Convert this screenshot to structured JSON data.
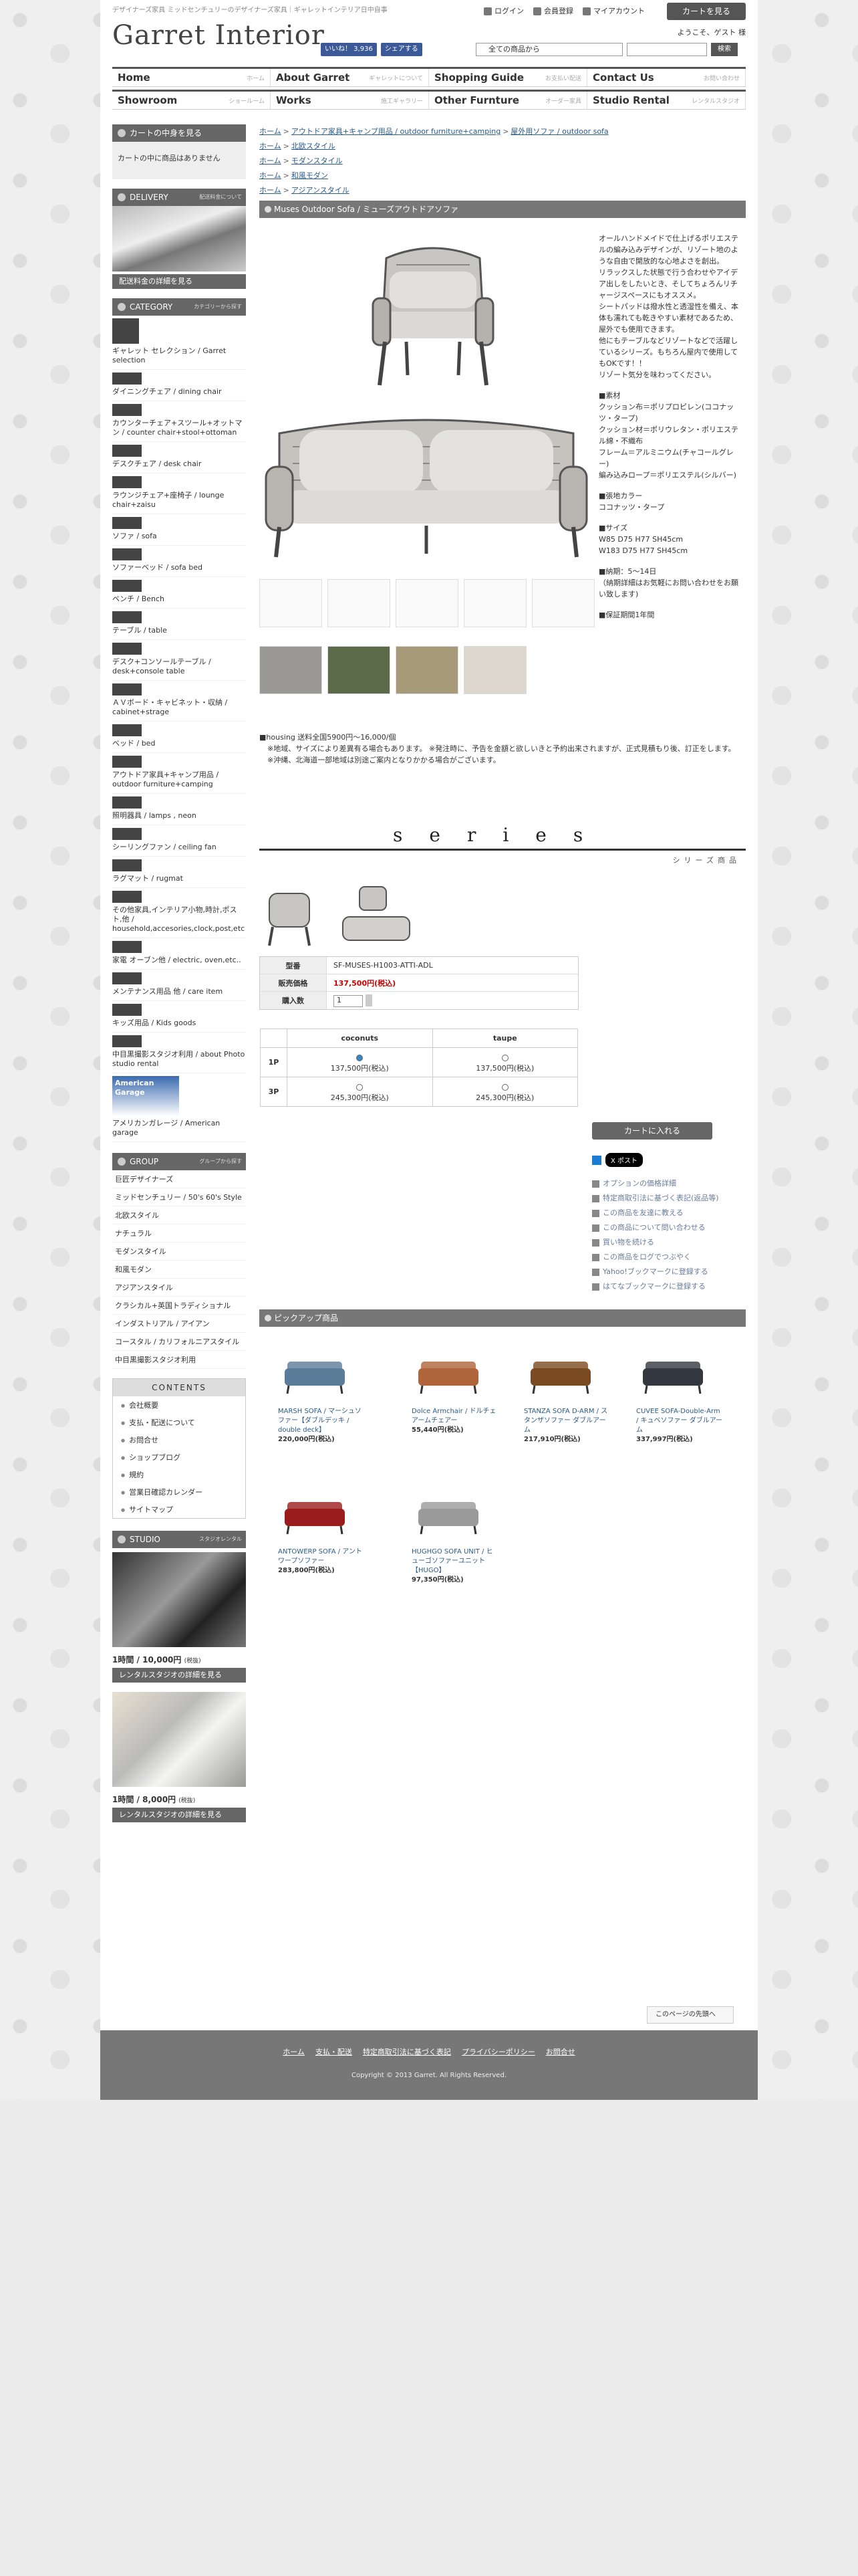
{
  "header": {
    "tagline": "デザイナーズ家具 ミッドセンチュリーのデザイナーズ家具｜ギャレットインテリア日中自事",
    "logo": "Garret Interior",
    "login": "ログイン",
    "register": "会員登録",
    "mypage": "マイアカウント",
    "cart_button": "カートを見る",
    "welcome": "ようこそ、ゲスト 様",
    "fb_like": "いいね！ 3,936",
    "fb_share": "シェアする",
    "search_select": "全ての商品から",
    "search_button": "検索"
  },
  "nav1": [
    {
      "label": "Home",
      "sub": "ホーム"
    },
    {
      "label": "About Garret",
      "sub": "ギャレットについて"
    },
    {
      "label": "Shopping Guide",
      "sub": "お支払い配送"
    },
    {
      "label": "Contact Us",
      "sub": "お問い合わせ"
    }
  ],
  "nav2": [
    {
      "label": "Showroom",
      "sub": "ショールーム"
    },
    {
      "label": "Works",
      "sub": "施工ギャラリー"
    },
    {
      "label": "Other Furnture",
      "sub": "オーダー家具"
    },
    {
      "label": "Studio Rental",
      "sub": "レンタルスタジオ"
    }
  ],
  "sidebar": {
    "cart_heading": "カートの中身を見る",
    "cart_empty": "カートの中に商品はありません",
    "delivery_heading": "DELIVERY",
    "delivery_sub": "配送料金について",
    "delivery_button": "配送料金の詳細を見る",
    "category_heading": "CATEGORY",
    "category_sub": "カテゴリーから探す",
    "categories": [
      "ギャレット セレクション / Garret selection",
      "ダイニングチェア / dining chair",
      "カウンターチェア+スツール+オットマン / counter chair+stool+ottoman",
      "デスクチェア / desk chair",
      "ラウンジチェア+座椅子 / lounge chair+zaisu",
      "ソファ / sofa",
      "ソファーベッド / sofa bed",
      "ベンチ / Bench",
      "テーブル / table",
      "デスク+コンソールテーブル / desk+console table",
      "ＡＶボード・キャビネット・収納 / cabinet+strage",
      "ベッド / bed",
      "アウトドア家具+キャンプ用品 / outdoor furniture+camping",
      "照明器具 / lamps , neon",
      "シーリングファン / ceiling fan",
      "ラグマット / rugmat",
      "その他家具,インテリア小物,時計,ポスト,他 / household,accesories,clock,post,etc",
      "家電 オーブン他 / electric, oven,etc..",
      "メンテナンス用品 他 / care item",
      "キッズ用品 / Kids goods",
      "中目黒撮影スタジオ利用 / about Photo studio rental",
      "アメリカンガレージ / American garage"
    ],
    "group_heading": "GROUP",
    "group_sub": "グループから探す",
    "groups": [
      "巨匠デザイナーズ",
      "ミッドセンチュリー / 50's 60's Style",
      "北欧スタイル",
      "ナチュラル",
      "モダンスタイル",
      "和風モダン",
      "アジアンスタイル",
      "クラシカル+英国トラディショナル",
      "インダストリアル / アイアン",
      "コースタル / カリフォルニアスタイル",
      "中目黒撮影スタジオ利用"
    ],
    "contents_heading": "CONTENTS",
    "contents": [
      "会社概要",
      "支払・配送について",
      "お問合せ",
      "ショップブログ",
      "規約",
      "営業日確認カレンダー",
      "サイトマップ"
    ],
    "studio_heading": "STUDIO",
    "studio_sub": "スタジオレンタル",
    "studio_price1": "1時間 / 10,000円",
    "studio_price2": "1時間 / 8,000円",
    "tax": "(税抜)",
    "studio_button": "レンタルスタジオの詳細を見る",
    "american_garage": "American Garage"
  },
  "breadcrumbs": [
    [
      "ホーム",
      "アウトドア家具+キャンプ用品 / outdoor furniture+camping",
      "屋外用ソファ / outdoor sofa"
    ],
    [
      "ホーム",
      "北欧スタイル"
    ],
    [
      "ホーム",
      "モダンスタイル"
    ],
    [
      "ホーム",
      "和風モダン"
    ],
    [
      "ホーム",
      "アジアンスタイル"
    ]
  ],
  "product": {
    "title": "Muses Outdoor Sofa / ミューズアウトドアソファ",
    "description": [
      "オールハンドメイドで仕上げるポリエステルの編み込みデザインが、リゾート地のような自由で開放的な心地よさを創出。",
      "リラックスした状態で行う合わせやアイデア出しをしたいとき、そしてちょろんリチャージスペースにもオススメ。",
      "シートパッドは撥水性と透湿性を備え、本体も濡れても乾きやすい素材であるため、屋外でも使用できます。",
      "他にもテーブルなどリゾートなどで活躍しているシリーズ。もちろん屋内で使用してもOKです！！",
      "リゾート気分を味わってください。"
    ],
    "material_label": "■素材",
    "materials": [
      "クッション布＝ポリプロピレン(ココナッツ・タープ)",
      "クッション材＝ポリウレタン・ポリエステル綿・不織布",
      "フレーム＝アルミニウム(チャコールグレー)",
      "編み込みロープ＝ポリエステル(シルバー)"
    ],
    "color_label": "■張地カラー",
    "colors": "ココナッツ・タープ",
    "size_label": "■サイズ",
    "sizes": [
      "W85 D75 H77 SH45cm",
      "W183 D75 H77 SH45cm"
    ],
    "delivery_label": "■納期：5〜14日",
    "delivery_note": "（納期詳細はお気軽にお問い合わせをお願い致します)",
    "warranty": "■保証期間1年間",
    "shipping_note": [
      "■housing 送料全国5900円〜16,000/個",
      "※地域、サイズにより差異有る場合もあります。 ※発注時に、予告を金額と欲しいきと予約出来されますが、正式見積もり後、訂正をします。",
      "※沖縄、北海道一部地域は別途ご案内となりかかる場合がございます。"
    ],
    "series_big": "series",
    "series_sub": "シリーズ商品",
    "model_label": "型番",
    "model": "SF-MUSES-H1003-ATTI-ADL",
    "price_label": "販売価格",
    "price": "137,500円(税込)",
    "qty_label": "購入数",
    "qty": "1",
    "options": {
      "cols": [
        "coconuts",
        "taupe"
      ],
      "rows": [
        {
          "label": "1P",
          "prices": [
            "137,500円(税込)",
            "137,500円(税込)"
          ]
        },
        {
          "label": "3P",
          "prices": [
            "245,300円(税込)",
            "245,300円(税込)"
          ]
        }
      ]
    },
    "add_to_cart": "カートに入れる",
    "x_post": "X ポスト",
    "links": [
      "オプションの価格詳細",
      "特定商取引法に基づく表記(返品等)",
      "この商品を友達に教える",
      "この商品について問い合わせる",
      "買い物を続ける",
      "この商品をログでつぶやく",
      "Yahoo!ブックマークに登録する",
      "はてなブックマークに登録する"
    ]
  },
  "pickup": {
    "heading": "ピックアップ商品",
    "items": [
      {
        "name": "MARSH SOFA / マーシュソファー【ダブルデッキ / double deck】",
        "price": "220,000円(税込)",
        "color": "#5a7c98"
      },
      {
        "name": "Dolce Armchair / ドルチェアームチェアー",
        "price": "55,440円(税込)",
        "color": "#b0643a"
      },
      {
        "name": "STANZA SOFA D-ARM / スタンザソファー ダブルアーム",
        "price": "217,910円(税込)",
        "color": "#7a4a22"
      },
      {
        "name": "CUVEE SOFA-Double-Arm / キュベソファー ダブルアーム",
        "price": "337,997円(税込)",
        "color": "#333840"
      },
      {
        "name": "ANTOWERP SOFA / アントワープソファー",
        "price": "283,800円(税込)",
        "color": "#9a1c1c"
      },
      {
        "name": "HUGHGO SOFA UNIT / ヒューゴソファーユニット【HUGO】",
        "price": "97,350円(税込)",
        "color": "#9a9a9a"
      }
    ]
  },
  "footer": {
    "back_to_top": "このページの先頭へ",
    "links": [
      "ホーム",
      "支払・配送",
      "特定商取引法に基づく表記",
      "プライバシーポリシー",
      "お問合せ"
    ],
    "copyright": "Copyright © 2013 Garret. All Rights Reserved."
  }
}
